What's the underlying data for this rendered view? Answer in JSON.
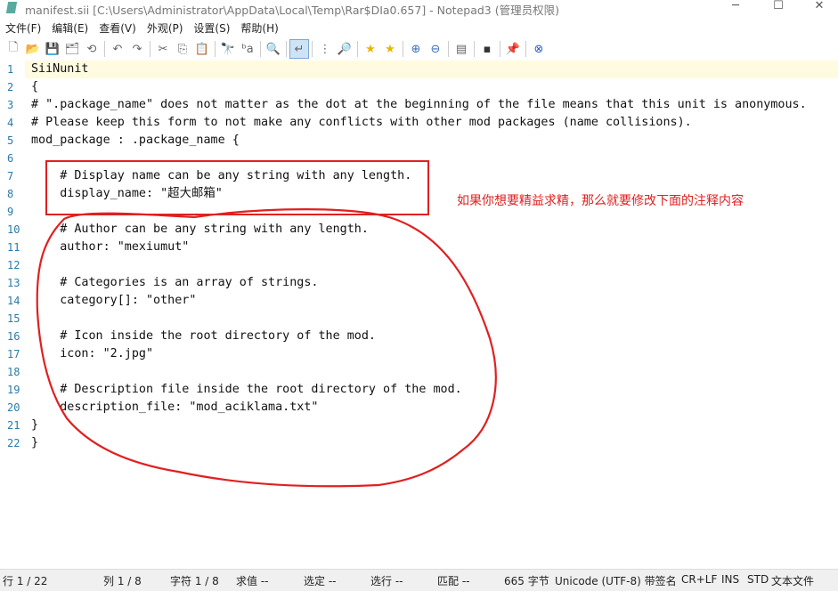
{
  "window": {
    "title": "manifest.sii [C:\\Users\\Administrator\\AppData\\Local\\Temp\\Rar$DIa0.657] - Notepad3  (管理员权限)",
    "minimize": "─",
    "maximize": "☐",
    "close": "✕"
  },
  "menu": [
    "文件(F)",
    "编辑(E)",
    "查看(V)",
    "外观(P)",
    "设置(S)",
    "帮助(H)"
  ],
  "toolbar": [
    "new-file",
    "open",
    "save",
    "save-as",
    "revert",
    "|",
    "undo",
    "redo",
    "|",
    "cut",
    "copy",
    "paste",
    "|",
    "find",
    "replace",
    "|",
    "find-in-files",
    "|",
    "word-wrap",
    "|",
    "bookmark-toggle",
    "find-next",
    "|",
    "favorites",
    "add-favorite",
    "|",
    "zoom-in",
    "zoom-out",
    "|",
    "view-scheme",
    "|",
    "console",
    "|",
    "pin",
    "|",
    "exit"
  ],
  "editor": {
    "current_line": 1,
    "lines": [
      "SiiNunit",
      "{",
      "# \".package_name\" does not matter as the dot at the beginning of the file means that this unit is anonymous.",
      "# Please keep this form to not make any conflicts with other mod packages (name collisions).",
      "mod_package : .package_name {",
      "",
      "    # Display name can be any string with any length.",
      "    display_name: \"超大邮箱\"",
      "",
      "    # Author can be any string with any length.",
      "    author: \"mexiumut\"",
      "",
      "    # Categories is an array of strings.",
      "    category[]: \"other\"",
      "",
      "    # Icon inside the root directory of the mod.",
      "    icon: \"2.jpg\"",
      "",
      "    # Description file inside the root directory of the mod.",
      "    description_file: \"mod_aciklama.txt\"",
      "}",
      "}"
    ]
  },
  "annotation": {
    "text": "如果你想要精益求精，那么就要修改下面的注释内容",
    "color": "#e02020"
  },
  "status": {
    "line": "行 1 / 22",
    "col": "列 1 / 8",
    "char": "字符 1 / 8",
    "eval": "求值 --",
    "sel": "选定 --",
    "sellines": "选行 --",
    "match": "匹配 --",
    "size": "665 字节",
    "encoding": "Unicode (UTF-8) 带签名",
    "eol": "CR+LF",
    "ins": "INS",
    "std": "STD",
    "type": "文本文件"
  }
}
